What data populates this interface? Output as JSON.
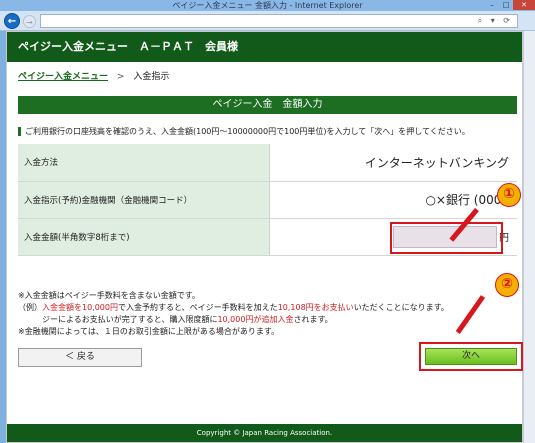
{
  "window": {
    "title": "ペイジー入金メニュー 金額入力 - Internet Explorer",
    "controls": {
      "minimize": "–",
      "maximize": "□",
      "close": "✕"
    }
  },
  "browser": {
    "back_icon": "back-arrow-icon",
    "forward_icon": "forward-arrow-icon",
    "address_icons": "⌕ ▾ ⟳"
  },
  "header": {
    "title": "ペイジー入金メニュー　Ａ－ＰＡＴ　会員様"
  },
  "breadcrumb": {
    "link": "ペイジー入金メニュー",
    "separator": ">",
    "current": "入金指示"
  },
  "section": {
    "title": "ペイジー入金　金額入力"
  },
  "intro": "ご利用銀行の口座残高を確認のうえ、入金金額(100円～10000000円で100円単位)を入力して「次へ」を押してください。",
  "form": {
    "rows": [
      {
        "label": "入金方法",
        "value": "インターネットバンキング"
      },
      {
        "label": "入金指示(予約)金融機関（金融機関コード）",
        "value": "○×銀行 (0000"
      },
      {
        "label": "入金金額(半角数字8桁まで)",
        "value": ""
      }
    ],
    "amount_unit": "円"
  },
  "notes": {
    "line1": "※入金金額はペイジー手数料を含まない金額です。",
    "line2_a": "（例）",
    "line2_b": "入金金額を10,000円",
    "line2_c": "で入金予約すると、ペイジー手数料を加えた",
    "line2_d": "10,108円をお支払い",
    "line2_e": "いただくことになります。",
    "line3_a": "ジーによるお支払いが完了すると、購入限度額に",
    "line3_b": "10,000円が追加入金",
    "line3_c": "されます。",
    "line4": "※金融機関によっては、１日のお取引金額に上限がある場合があります。"
  },
  "buttons": {
    "back": "＜ 戻る",
    "next": "次へ"
  },
  "annotations": {
    "badge1": "①",
    "badge2": "②"
  },
  "footer": {
    "copyright": "Copyright © Japan Racing Association."
  }
}
